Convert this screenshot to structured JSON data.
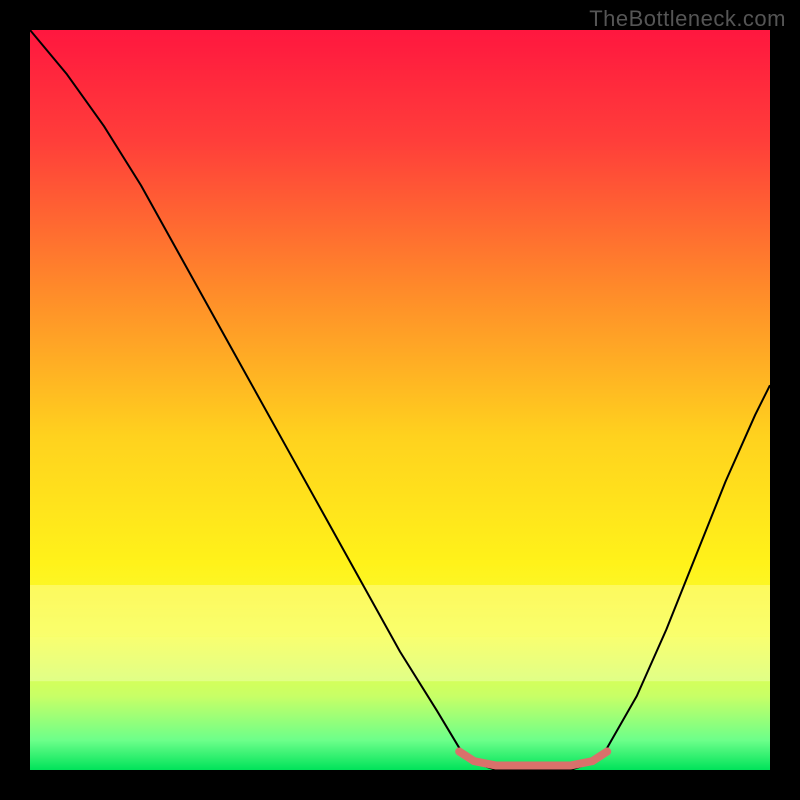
{
  "watermark": "TheBottleneck.com",
  "chart_data": {
    "type": "line",
    "title": "",
    "xlabel": "",
    "ylabel": "",
    "xlim": [
      0,
      100
    ],
    "ylim": [
      0,
      100
    ],
    "grid": false,
    "legend": false,
    "background_gradient": {
      "stops": [
        {
          "offset": 0.0,
          "color": "#ff173f"
        },
        {
          "offset": 0.15,
          "color": "#ff3e3a"
        },
        {
          "offset": 0.35,
          "color": "#ff8a2a"
        },
        {
          "offset": 0.55,
          "color": "#ffd21e"
        },
        {
          "offset": 0.72,
          "color": "#fff21a"
        },
        {
          "offset": 0.82,
          "color": "#f6ff3a"
        },
        {
          "offset": 0.9,
          "color": "#c8ff66"
        },
        {
          "offset": 0.96,
          "color": "#6cff8a"
        },
        {
          "offset": 1.0,
          "color": "#00e35a"
        }
      ],
      "highlight_bands": [
        {
          "y": 75,
          "height": 7,
          "color": "#ffffcc",
          "opacity": 0.35
        },
        {
          "y": 82,
          "height": 6,
          "color": "#ffffee",
          "opacity": 0.3
        }
      ]
    },
    "series": [
      {
        "name": "bottleneck-curve",
        "color": "#000000",
        "width": 2,
        "points": [
          {
            "x": 0,
            "y": 100
          },
          {
            "x": 5,
            "y": 94
          },
          {
            "x": 10,
            "y": 87
          },
          {
            "x": 15,
            "y": 79
          },
          {
            "x": 20,
            "y": 70
          },
          {
            "x": 25,
            "y": 61
          },
          {
            "x": 30,
            "y": 52
          },
          {
            "x": 35,
            "y": 43
          },
          {
            "x": 40,
            "y": 34
          },
          {
            "x": 45,
            "y": 25
          },
          {
            "x": 50,
            "y": 16
          },
          {
            "x": 55,
            "y": 8
          },
          {
            "x": 58,
            "y": 3
          },
          {
            "x": 60,
            "y": 1
          },
          {
            "x": 63,
            "y": 0
          },
          {
            "x": 68,
            "y": 0
          },
          {
            "x": 73,
            "y": 0
          },
          {
            "x": 76,
            "y": 1
          },
          {
            "x": 78,
            "y": 3
          },
          {
            "x": 82,
            "y": 10
          },
          {
            "x": 86,
            "y": 19
          },
          {
            "x": 90,
            "y": 29
          },
          {
            "x": 94,
            "y": 39
          },
          {
            "x": 98,
            "y": 48
          },
          {
            "x": 100,
            "y": 52
          }
        ]
      },
      {
        "name": "optimal-range-marker",
        "color": "#d9716b",
        "width": 8,
        "linecap": "round",
        "points": [
          {
            "x": 58,
            "y": 2.5
          },
          {
            "x": 60,
            "y": 1.2
          },
          {
            "x": 63,
            "y": 0.6
          },
          {
            "x": 68,
            "y": 0.6
          },
          {
            "x": 73,
            "y": 0.6
          },
          {
            "x": 76,
            "y": 1.2
          },
          {
            "x": 78,
            "y": 2.5
          }
        ]
      }
    ]
  }
}
